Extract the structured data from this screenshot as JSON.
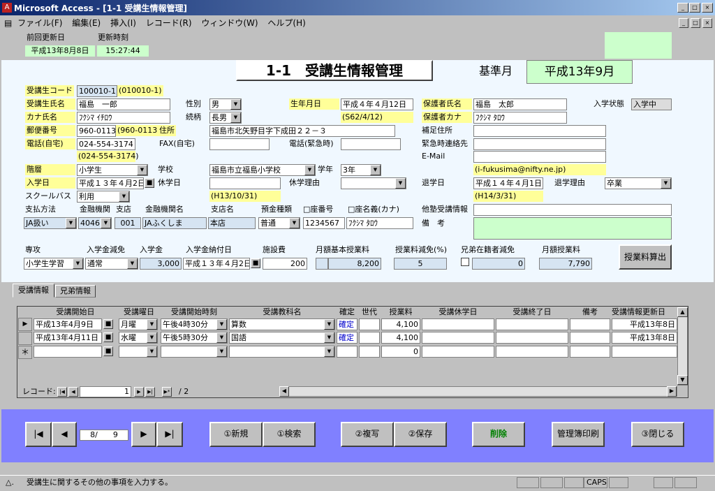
{
  "window": {
    "title": "Microsoft Access - [1-1 受講生情報管理]",
    "min": "_",
    "max": "□",
    "close": "×"
  },
  "menu": [
    "ファイル(F)",
    "編集(E)",
    "挿入(I)",
    "レコード(R)",
    "ウィンドウ(W)",
    "ヘルプ(H)"
  ],
  "top": {
    "prev_update_label": "前回更新日",
    "prev_update_time_label": "更新時刻",
    "prev_update": "平成13年8月8日",
    "prev_time": "15:27:44"
  },
  "header": {
    "form_title": "1-1　受講生情報管理",
    "base_month_label": "基準月",
    "base_month": "平成13年9月"
  },
  "fields": {
    "code_label": "受講生コード",
    "code": "100010-1",
    "code_note": "(010010-1)",
    "name_label": "受講生氏名",
    "name": "福島　一郎",
    "sex_label": "性別",
    "sex": "男",
    "birth_label": "生年月日",
    "birth": "平成４年４月12日",
    "birth_note": "(S62/4/12)",
    "guardian_label": "保護者氏名",
    "guardian": "福島　太郎",
    "status_label": "入学状態",
    "status": "入学中",
    "kana_label": "カナ氏名",
    "kana": "ﾌｸｼﾏ ｲﾁﾛｳ",
    "relation_label": "続柄",
    "relation": "長男",
    "guardian_kana_label": "保護者カナ",
    "guardian_kana": "ﾌｸｼﾏ ﾀﾛｳ",
    "zip_label": "郵便番号",
    "zip": "960-0113",
    "zip_note": "(960-0113)",
    "addr_label": "住所",
    "addr": "福島市北矢野目字下成田２２－３",
    "sub_addr_label": "補足住所",
    "tel_label": "電話(自宅)",
    "tel": "024-554-3174",
    "fax_label": "FAX(自宅)",
    "etel_label": "電話(緊急時)",
    "econtact_label": "緊急時連絡先",
    "tel_note": "(024-554-3174)",
    "email_label": "E-Mail",
    "email_note": "(i-fukusima@nifty.ne.jp)",
    "grade_label": "階層",
    "grade": "小学生",
    "school_label": "学校",
    "school": "福島市立福島小学校",
    "year_label": "学年",
    "year": "3年",
    "enroll_label": "入学日",
    "enroll": "平成１３年４月2日",
    "leave_label": "休学日",
    "leave_reason_label": "休学理由",
    "quit_label": "退学日",
    "quit": "平成１４年４月1日",
    "quit_reason_label": "退学理由",
    "quit_reason": "卒業",
    "bus_label": "スクールバス",
    "bus": "利用",
    "leave_note": "(H13/10/31)",
    "quit_note": "(H14/3/31)",
    "pay_label": "支払方法",
    "bank_label": "金融機関",
    "branch_label": "支店",
    "bank_name_label": "金融機関名",
    "branch_name_label": "支店名",
    "acc_type_label": "預金種類",
    "acc_no_label": "□座番号",
    "acc_holder_label": "□座名義(カナ)",
    "other_label": "他塾受講情報",
    "pay": "JA扱い",
    "bank": "4046",
    "branch": "001",
    "bank_name": "JAふくしま",
    "branch_name": "本店",
    "acc_type": "普通",
    "acc_no": "1234567",
    "acc_holder": "ﾌｸｼﾏ ﾀﾛｳ",
    "memo_label": "備　考",
    "major_label": "専攻",
    "discount_label": "入学金減免",
    "fee_label": "入学金",
    "fee_date_label": "入学金納付日",
    "facility_label": "施設費",
    "monthly_label": "月額基本授業料",
    "reduce_label": "授業料減免(%)",
    "sibling_label": "兄弟在籍者減免",
    "monthly_fee_label": "月額授業料",
    "major": "小学生学習",
    "discount": "通常",
    "fee": "3,000",
    "fee_date": "平成１３年４月2日",
    "facility": "200",
    "monthly": "8,200",
    "reduce": "5",
    "sibling": "0",
    "monthly_fee": "7,790",
    "calc_btn": "授業料算出"
  },
  "tabs": [
    "受講情報",
    "兄弟情報"
  ],
  "grid": {
    "headers": [
      "受講開始日",
      "受講曜日",
      "受講開始時刻",
      "受講教科名",
      "確定",
      "世代",
      "授業料",
      "受講休学日",
      "受講終了日",
      "備考",
      "受講情報更新日"
    ],
    "rows": [
      {
        "start": "平成13年4月9日",
        "day": "月曜",
        "time": "午後4時30分",
        "subject": "算数",
        "fixed": "確定",
        "fee": "4,100",
        "upd": "平成13年8日"
      },
      {
        "start": "平成13年4月11日",
        "day": "水曜",
        "time": "午後5時30分",
        "subject": "国語",
        "fixed": "確定",
        "fee": "4,100",
        "upd": "平成13年8日"
      },
      {
        "start": "",
        "day": "",
        "time": "",
        "subject": "",
        "fixed": "",
        "fee": "0",
        "upd": ""
      }
    ],
    "nav_label": "レコード:",
    "nav_current": "1",
    "nav_total": "/ 2"
  },
  "footer": {
    "record_pos": "8/　　9",
    "new": "①新規",
    "search": "①検索",
    "copy": "②複写",
    "save": "②保存",
    "delete": "削除",
    "print": "管理簿印刷",
    "close": "③閉じる"
  },
  "status": {
    "text": "受講生に関するその他の事項を入力する。",
    "caps": "CAPS"
  },
  "colors": {
    "titlebar": "#0a246a",
    "footer": "#8080ff",
    "yellow": "#ffff99",
    "green": "#ccffcc",
    "delete_green": "#008000"
  }
}
